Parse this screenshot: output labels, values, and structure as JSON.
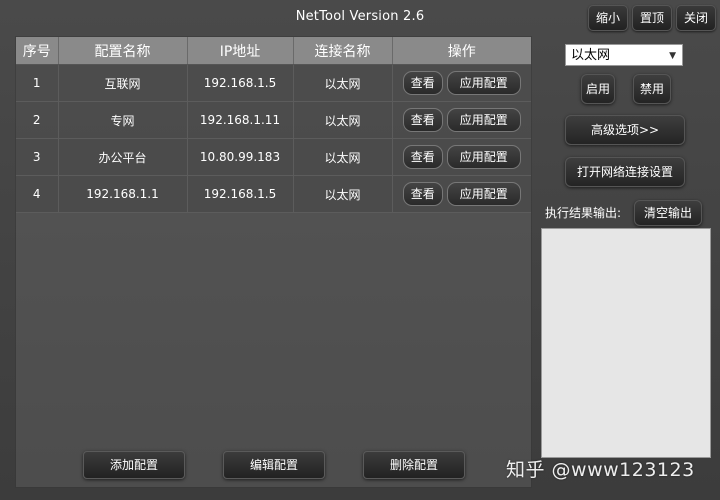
{
  "window": {
    "title": "NetTool Version 2.6",
    "minimize_label": "缩小",
    "pin_label": "置顶",
    "close_label": "关闭"
  },
  "table": {
    "headers": [
      "序号",
      "配置名称",
      "IP地址",
      "连接名称",
      "操作"
    ],
    "rows": [
      {
        "index": "1",
        "name": "互联网",
        "ip": "192.168.1.5",
        "connection": "以太网",
        "view": "查看",
        "apply": "应用配置"
      },
      {
        "index": "2",
        "name": "专网",
        "ip": "192.168.1.11",
        "connection": "以太网",
        "view": "查看",
        "apply": "应用配置"
      },
      {
        "index": "3",
        "name": "办公平台",
        "ip": "10.80.99.183",
        "connection": "以太网",
        "view": "查看",
        "apply": "应用配置"
      },
      {
        "index": "4",
        "name": "192.168.1.1",
        "ip": "192.168.1.5",
        "connection": "以太网",
        "view": "查看",
        "apply": "应用配置"
      }
    ]
  },
  "footer": {
    "add_label": "添加配置",
    "edit_label": "编辑配置",
    "delete_label": "删除配置"
  },
  "side": {
    "adapter_selected": "以太网",
    "enable_label": "启用",
    "disable_label": "禁用",
    "advanced_label": "高级选项>>",
    "open_settings_label": "打开网络连接设置",
    "output_label": "执行结果输出:",
    "clear_output_label": "清空输出"
  },
  "watermark": "知乎 @www123123"
}
